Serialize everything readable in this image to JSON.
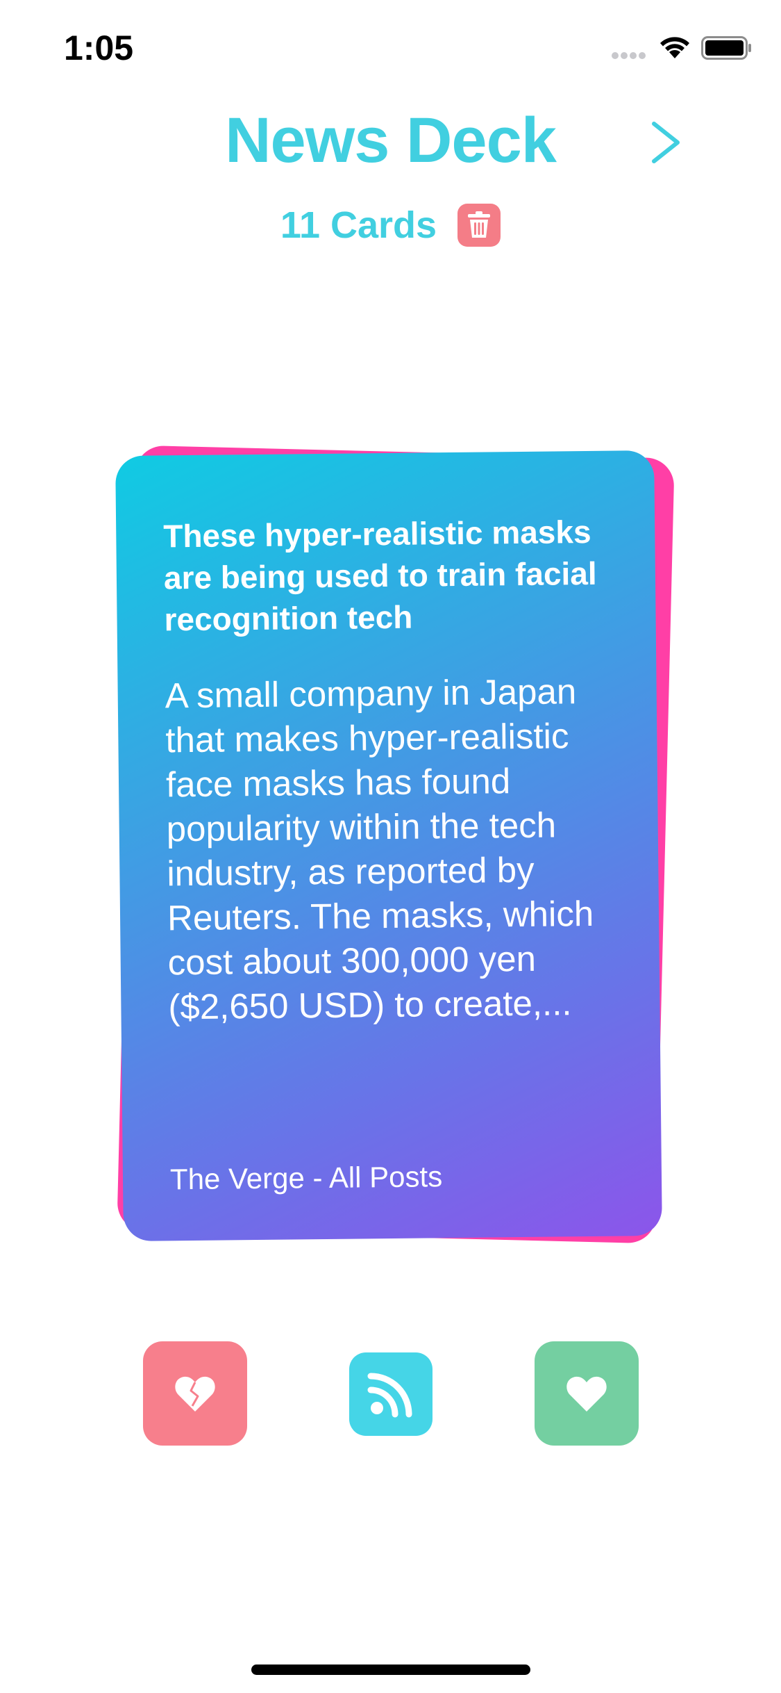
{
  "status_bar": {
    "time": "1:05"
  },
  "header": {
    "title": "News Deck",
    "card_count": "11 Cards"
  },
  "card": {
    "title": "These hyper-realistic masks are being used to train facial recognition tech",
    "summary": "A small company in Japan that makes hyper-realistic face masks has found popularity within the tech industry, as reported by Reuters. The masks, which cost about 300,000 yen ($2,650 USD) to create,...",
    "source": "The Verge -  All Posts"
  },
  "actions": {
    "dislike_icon": "broken-heart-icon",
    "feeds_icon": "rss-icon",
    "like_icon": "heart-icon"
  },
  "colors": {
    "accent": "#41cfe0",
    "dislike": "#f77f8c",
    "feeds": "#45d5e7",
    "like": "#74cfa1",
    "card_back": "#ff3fa6",
    "card_gradient_start": "#10cbe3",
    "card_gradient_end": "#8c55ea"
  }
}
